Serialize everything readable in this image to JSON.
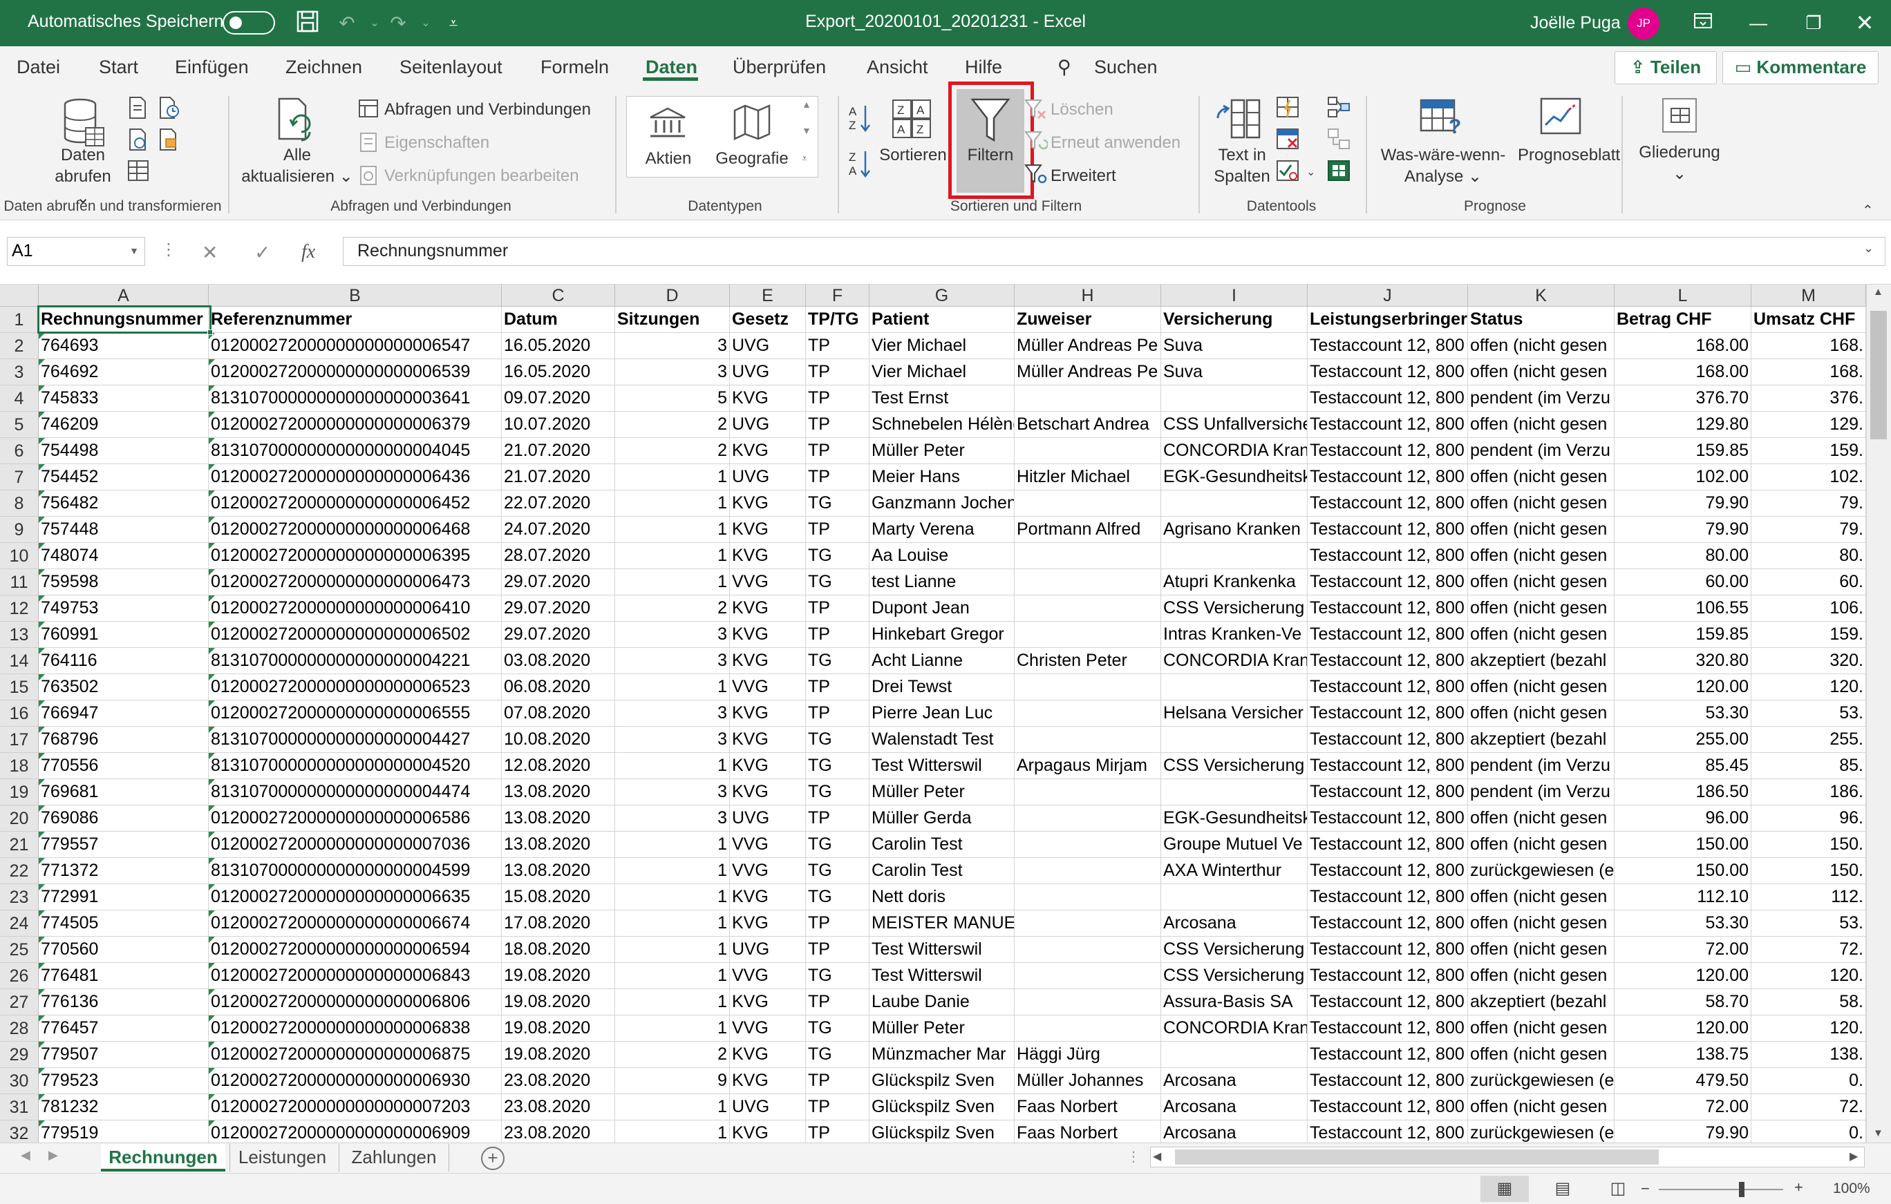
{
  "titlebar": {
    "autosave": "Automatisches Speichern",
    "doc_title": "Export_20200101_20201231  -  Excel",
    "user": "Joëlle Puga",
    "initials": "JP"
  },
  "menu": {
    "tabs": [
      "Datei",
      "Start",
      "Einfügen",
      "Zeichnen",
      "Seitenlayout",
      "Formeln",
      "Daten",
      "Überprüfen",
      "Ansicht",
      "Hilfe"
    ],
    "active_tab": "Daten",
    "search": "Suchen",
    "share": "Teilen",
    "comments": "Kommentare"
  },
  "ribbon": {
    "daten_abrufen": [
      "Daten",
      "abrufen ⌄"
    ],
    "group1": "Daten abrufen und transformieren",
    "alle_aktualisieren": [
      "Alle",
      "aktualisieren ⌄"
    ],
    "abfragen": "Abfragen und Verbindungen",
    "eigenschaften": "Eigenschaften",
    "verknuepfungen": "Verknüpfungen bearbeiten",
    "group2": "Abfragen und Verbindungen",
    "aktien": "Aktien",
    "geografie": "Geografie",
    "group3": "Datentypen",
    "sortieren": "Sortieren",
    "filtern": "Filtern",
    "loeschen": "Löschen",
    "erneut": "Erneut anwenden",
    "erweitert": "Erweitert",
    "group4": "Sortieren und Filtern",
    "text_in_spalten": [
      "Text in",
      "Spalten"
    ],
    "group5": "Datentools",
    "was_waere": [
      "Was-wäre-wenn-",
      "Analyse ⌄"
    ],
    "prognoseblatt": "Prognoseblatt",
    "group6": "Prognose",
    "gliederung": [
      "Gliederung",
      "⌄"
    ]
  },
  "formula_bar": {
    "name_box": "A1",
    "fx": "fx",
    "content": "Rechnungsnummer"
  },
  "columns": [
    "A",
    "B",
    "C",
    "D",
    "E",
    "F",
    "G",
    "H",
    "I",
    "J",
    "K",
    "L",
    "M"
  ],
  "headers": [
    "Rechnungsnummer",
    "Referenznummer",
    "Datum",
    "Sitzungen",
    "Gesetz",
    "TP/TG",
    "Patient",
    "Zuweiser",
    "Versicherung",
    "Leistungserbringer",
    "Status",
    "Betrag CHF",
    "Umsatz CHF"
  ],
  "rows": [
    [
      "764693",
      "012000272000000000000006547",
      "16.05.2020",
      "3",
      "UVG",
      "TP",
      "Vier Michael",
      "Müller Andreas Pe",
      "Suva",
      "Testaccount 12, 800",
      "offen (nicht gesen",
      "168.00",
      "168."
    ],
    [
      "764692",
      "012000272000000000000006539",
      "16.05.2020",
      "3",
      "UVG",
      "TP",
      "Vier Michael",
      "Müller Andreas Pe",
      "Suva",
      "Testaccount 12, 800",
      "offen (nicht gesen",
      "168.00",
      "168."
    ],
    [
      "745833",
      "813107000000000000000003641",
      "09.07.2020",
      "5",
      "KVG",
      "TP",
      "Test Ernst",
      "",
      "",
      "Testaccount 12, 800",
      "pendent (im Verzu",
      "376.70",
      "376."
    ],
    [
      "746209",
      "012000272000000000000006379",
      "10.07.2020",
      "2",
      "UVG",
      "TP",
      "Schnebelen Hélène",
      "Betschart Andrea",
      "CSS Unfallversiche",
      "Testaccount 12, 800",
      "offen (nicht gesen",
      "129.80",
      "129."
    ],
    [
      "754498",
      "813107000000000000000004045",
      "21.07.2020",
      "2",
      "KVG",
      "TP",
      "Müller Peter",
      "",
      "CONCORDIA Kran",
      "Testaccount 12, 800",
      "pendent (im Verzu",
      "159.85",
      "159."
    ],
    [
      "754452",
      "012000272000000000000006436",
      "21.07.2020",
      "1",
      "UVG",
      "TP",
      "Meier Hans",
      "Hitzler Michael",
      "EGK-Gesundheitsk",
      "Testaccount 12, 800",
      "offen (nicht gesen",
      "102.00",
      "102."
    ],
    [
      "756482",
      "012000272000000000000006452",
      "22.07.2020",
      "1",
      "KVG",
      "TG",
      "Ganzmann Jochen",
      "",
      "",
      "Testaccount 12, 800",
      "offen (nicht gesen",
      "79.90",
      "79."
    ],
    [
      "757448",
      "012000272000000000000006468",
      "24.07.2020",
      "1",
      "KVG",
      "TP",
      "Marty Verena",
      "Portmann Alfred",
      "Agrisano Kranken",
      "Testaccount 12, 800",
      "offen (nicht gesen",
      "79.90",
      "79."
    ],
    [
      "748074",
      "012000272000000000000006395",
      "28.07.2020",
      "1",
      "KVG",
      "TG",
      "Aa Louise",
      "",
      "",
      "Testaccount 12, 800",
      "offen (nicht gesen",
      "80.00",
      "80."
    ],
    [
      "759598",
      "012000272000000000000006473",
      "29.07.2020",
      "1",
      "VVG",
      "TG",
      "test Lianne",
      "",
      "Atupri Krankenka",
      "Testaccount 12, 800",
      "offen (nicht gesen",
      "60.00",
      "60."
    ],
    [
      "749753",
      "012000272000000000000006410",
      "29.07.2020",
      "2",
      "KVG",
      "TP",
      "Dupont Jean",
      "",
      "CSS Versicherung",
      "Testaccount 12, 800",
      "offen (nicht gesen",
      "106.55",
      "106."
    ],
    [
      "760991",
      "012000272000000000000006502",
      "29.07.2020",
      "3",
      "KVG",
      "TP",
      "Hinkebart Gregor",
      "",
      "Intras Kranken-Ve",
      "Testaccount 12, 800",
      "offen (nicht gesen",
      "159.85",
      "159."
    ],
    [
      "764116",
      "813107000000000000000004221",
      "03.08.2020",
      "3",
      "KVG",
      "TG",
      "Acht Lianne",
      "Christen Peter",
      "CONCORDIA Kran",
      "Testaccount 12, 800",
      "akzeptiert (bezahl",
      "320.80",
      "320."
    ],
    [
      "763502",
      "012000272000000000000006523",
      "06.08.2020",
      "1",
      "VVG",
      "TP",
      "Drei Tewst",
      "",
      "",
      "Testaccount 12, 800",
      "offen (nicht gesen",
      "120.00",
      "120."
    ],
    [
      "766947",
      "012000272000000000000006555",
      "07.08.2020",
      "3",
      "KVG",
      "TP",
      "Pierre Jean Luc",
      "",
      "Helsana Versicher",
      "Testaccount 12, 800",
      "offen (nicht gesen",
      "53.30",
      "53."
    ],
    [
      "768796",
      "813107000000000000000004427",
      "10.08.2020",
      "3",
      "KVG",
      "TG",
      "Walenstadt Test",
      "",
      "",
      "Testaccount 12, 800",
      "akzeptiert (bezahl",
      "255.00",
      "255."
    ],
    [
      "770556",
      "813107000000000000000004520",
      "12.08.2020",
      "1",
      "KVG",
      "TG",
      "Test Witterswil",
      "Arpagaus Mirjam",
      "CSS Versicherung",
      "Testaccount 12, 800",
      "pendent (im Verzu",
      "85.45",
      "85."
    ],
    [
      "769681",
      "813107000000000000000004474",
      "13.08.2020",
      "3",
      "KVG",
      "TG",
      "Müller Peter",
      "",
      "",
      "Testaccount 12, 800",
      "pendent (im Verzu",
      "186.50",
      "186."
    ],
    [
      "769086",
      "012000272000000000000006586",
      "13.08.2020",
      "3",
      "UVG",
      "TP",
      "Müller Gerda",
      "",
      "EGK-Gesundheitsk",
      "Testaccount 12, 800",
      "offen (nicht gesen",
      "96.00",
      "96."
    ],
    [
      "779557",
      "012000272000000000000007036",
      "13.08.2020",
      "1",
      "VVG",
      "TG",
      "Carolin Test",
      "",
      "Groupe Mutuel Ve",
      "Testaccount 12, 800",
      "offen (nicht gesen",
      "150.00",
      "150."
    ],
    [
      "771372",
      "813107000000000000000004599",
      "13.08.2020",
      "1",
      "VVG",
      "TG",
      "Carolin Test",
      "",
      "AXA Winterthur",
      "Testaccount 12, 800",
      "zurückgewiesen (e",
      "150.00",
      "150."
    ],
    [
      "772991",
      "012000272000000000000006635",
      "15.08.2020",
      "1",
      "KVG",
      "TG",
      "Nett doris",
      "",
      "",
      "Testaccount 12, 800",
      "offen (nicht gesen",
      "112.10",
      "112."
    ],
    [
      "774505",
      "012000272000000000000006674",
      "17.08.2020",
      "1",
      "KVG",
      "TP",
      "MEISTER MANUEL",
      "",
      "Arcosana",
      "Testaccount 12, 800",
      "offen (nicht gesen",
      "53.30",
      "53."
    ],
    [
      "770560",
      "012000272000000000000006594",
      "18.08.2020",
      "1",
      "UVG",
      "TP",
      "Test Witterswil",
      "",
      "CSS Versicherung",
      "Testaccount 12, 800",
      "offen (nicht gesen",
      "72.00",
      "72."
    ],
    [
      "776481",
      "012000272000000000000006843",
      "19.08.2020",
      "1",
      "VVG",
      "TG",
      "Test Witterswil",
      "",
      "CSS Versicherung",
      "Testaccount 12, 800",
      "offen (nicht gesen",
      "120.00",
      "120."
    ],
    [
      "776136",
      "012000272000000000000006806",
      "19.08.2020",
      "1",
      "KVG",
      "TP",
      "Laube Danie",
      "",
      "Assura-Basis SA",
      "Testaccount 12, 800",
      "akzeptiert (bezahl",
      "58.70",
      "58."
    ],
    [
      "776457",
      "012000272000000000000006838",
      "19.08.2020",
      "1",
      "VVG",
      "TG",
      "Müller Peter",
      "",
      "CONCORDIA Kran",
      "Testaccount 12, 800",
      "offen (nicht gesen",
      "120.00",
      "120."
    ],
    [
      "779507",
      "012000272000000000000006875",
      "19.08.2020",
      "2",
      "KVG",
      "TG",
      "Münzmacher Mar",
      "Häggi Jürg",
      "",
      "Testaccount 12, 800",
      "offen (nicht gesen",
      "138.75",
      "138."
    ],
    [
      "779523",
      "012000272000000000000006930",
      "23.08.2020",
      "9",
      "KVG",
      "TP",
      "Glückspilz Sven",
      "Müller Johannes",
      "Arcosana",
      "Testaccount 12, 800",
      "zurückgewiesen (e",
      "479.50",
      "0."
    ],
    [
      "781232",
      "012000272000000000000007203",
      "23.08.2020",
      "1",
      "UVG",
      "TP",
      "Glückspilz Sven",
      "Faas Norbert",
      "Arcosana",
      "Testaccount 12, 800",
      "offen (nicht gesen",
      "72.00",
      "72."
    ],
    [
      "779519",
      "012000272000000000000006909",
      "23.08.2020",
      "1",
      "KVG",
      "TP",
      "Glückspilz Sven",
      "Faas Norbert",
      "Arcosana",
      "Testaccount 12, 800",
      "zurückgewiesen (e",
      "79.90",
      "0."
    ]
  ],
  "sheets": [
    "Rechnungen",
    "Leistungen",
    "Zahlungen"
  ],
  "active_sheet": "Rechnungen",
  "zoom": "100%",
  "colors": {
    "excel_green": "#217346",
    "highlight_red": "#e0161f",
    "avatar": "#e3008c"
  }
}
